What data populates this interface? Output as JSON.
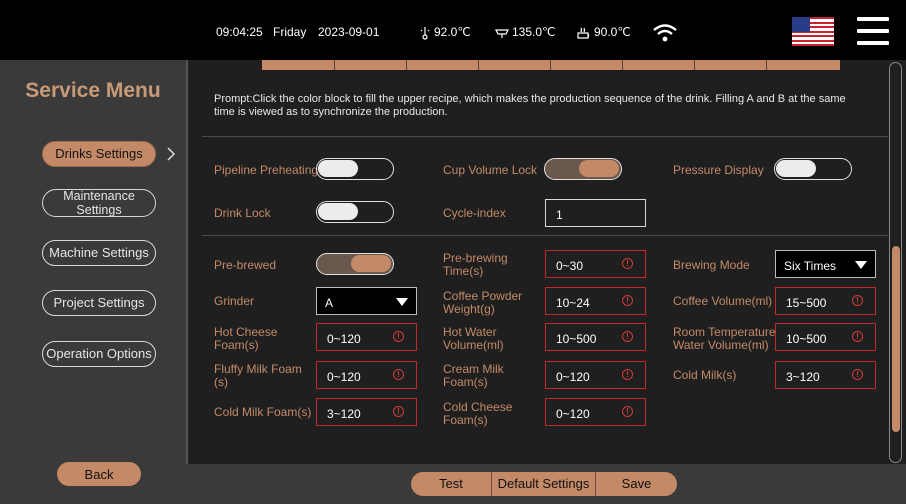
{
  "status": {
    "time": "09:04:25",
    "day": "Friday",
    "date": "2023-09-01",
    "temp1": "92.0℃",
    "temp2": "135.0℃",
    "temp3": "90.0℃"
  },
  "sidebar": {
    "title": "Service Menu",
    "items": [
      {
        "label": "Drinks Settings",
        "active": true
      },
      {
        "label": "Maintenance Settings",
        "active": false
      },
      {
        "label": "Machine Settings",
        "active": false
      },
      {
        "label": "Project Settings",
        "active": false
      },
      {
        "label": "Operation Options",
        "active": false
      }
    ],
    "back_label": "Back"
  },
  "prompt": "Prompt:Click the color block to fill the upper recipe, which makes the production sequence of the drink. Filling A and B at the same time is viewed as to synchronize the production.",
  "toggles": {
    "pipeline_preheating": {
      "label": "Pipeline Preheating",
      "on": false
    },
    "cup_volume_lock": {
      "label": "Cup Volume Lock",
      "on": true
    },
    "pressure_display": {
      "label": "Pressure Display",
      "on": false
    },
    "drink_lock": {
      "label": "Drink Lock",
      "on": false
    },
    "pre_brewed": {
      "label": "Pre-brewed",
      "on": true
    }
  },
  "cycle_index": {
    "label": "Cycle-index",
    "value": "1"
  },
  "fields": {
    "pre_brewing_time": {
      "label": "Pre-brewing Time(s)",
      "value": "0~30"
    },
    "brewing_mode": {
      "label": "Brewing Mode",
      "value": "Six Times"
    },
    "grinder": {
      "label": "Grinder",
      "value": "A"
    },
    "coffee_powder_weight": {
      "label": "Coffee Powder Weight(g)",
      "value": "10~24"
    },
    "coffee_volume": {
      "label": "Coffee Volume(ml)",
      "value": "15~500"
    },
    "hot_cheese_foam": {
      "label": "Hot Cheese Foam(s)",
      "value": "0~120"
    },
    "hot_water_volume": {
      "label": "Hot Water Volume(ml)",
      "value": "10~500"
    },
    "room_temp_water_volume": {
      "label": "Room Temperature Water Volume(ml)",
      "value": "10~500"
    },
    "fluffy_milk_foam": {
      "label": "Fluffy Milk Foam (s)",
      "value": "0~120"
    },
    "cream_milk_foam": {
      "label": "Cream Milk Foam(s)",
      "value": "0~120"
    },
    "cold_milk": {
      "label": "Cold Milk(s)",
      "value": "3~120"
    },
    "cold_milk_foam": {
      "label": "Cold Milk Foam(s)",
      "value": "3~120"
    },
    "cold_cheese_foam": {
      "label": "Cold Cheese Foam(s)",
      "value": "0~120"
    }
  },
  "actions": {
    "test": "Test",
    "default_settings": "Default Settings",
    "save": "Save"
  },
  "colors": {
    "accent": "#c48a67",
    "warning_border": "#c22a2a"
  },
  "icons": [
    "thermometer-icon",
    "steam-icon",
    "cup-icon",
    "wifi-icon",
    "us-flag-icon",
    "menu-icon",
    "chevron-right-icon",
    "warning-icon"
  ]
}
